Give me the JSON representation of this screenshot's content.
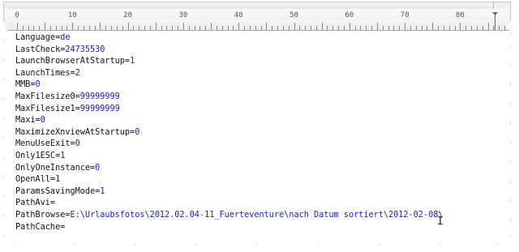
{
  "ruler": {
    "numbers": [
      "0",
      "10",
      "20",
      "30",
      "40",
      "50",
      "60",
      "70",
      "80"
    ]
  },
  "editor": {
    "lines": [
      {
        "key": "Language=",
        "value": "de"
      },
      {
        "key": "LastCheck=",
        "value": "24735530"
      },
      {
        "key": "LaunchBrowserAtStartup=",
        "value": "1"
      },
      {
        "key": "LaunchTimes=",
        "value": "2"
      },
      {
        "key": "MMB=",
        "value": "0"
      },
      {
        "key": "MaxFilesize0=",
        "value": "99999999"
      },
      {
        "key": "MaxFilesize1=",
        "value": "99999999"
      },
      {
        "key": "Maxi=",
        "value": "0"
      },
      {
        "key": "MaximizeXnviewAtStartup=",
        "value": "0"
      },
      {
        "key": "MenuUseExit=",
        "value": "0"
      },
      {
        "key": "Only1ESC=",
        "value": "1"
      },
      {
        "key": "OnlyOneInstance=",
        "value": "0"
      },
      {
        "key": "OpenAll=",
        "value": "1"
      },
      {
        "key": "ParamsSavingMode=",
        "value": "1"
      },
      {
        "key": "PathAvi=",
        "value": ""
      },
      {
        "key": "PathBrowse=",
        "value": "E:\\Urlaubsfotos\\2012.02.04-11_Fuerteventure\\nach Datum sortiert\\2012-02-08\\"
      },
      {
        "key": "PathCache=",
        "value": ""
      }
    ]
  },
  "colors": {
    "value_text": "#1c1cc0",
    "key_text": "#111111"
  }
}
